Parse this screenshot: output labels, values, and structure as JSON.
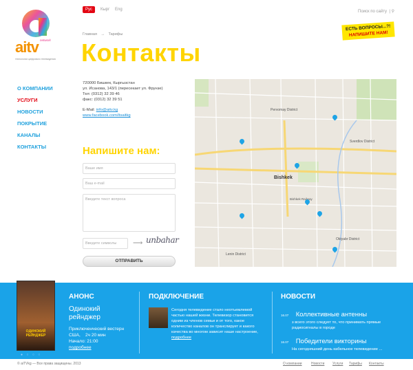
{
  "logo": {
    "name": "aitv",
    "tag": "network",
    "tagline": "технологии цифрового телевидения"
  },
  "languages": [
    "Рус",
    "Кырг",
    "Eng"
  ],
  "search": {
    "label": "Поиск по сайту"
  },
  "breadcrumb": [
    "Главная",
    "→",
    "Тарифы"
  ],
  "page_title": "Контакты",
  "ask": {
    "line1": "ЕСТЬ ВОПРОСЫ...?!",
    "line2": "НАПИШИТЕ НАМ!"
  },
  "nav": [
    "О КОМПАНИИ",
    "УСЛУГИ",
    "НОВОСТИ",
    "ПОКРЫТИЕ",
    "КАНАЛЫ",
    "КОНТАКТЫ"
  ],
  "address": {
    "line1": "720000 Бишкек, Кыргызстан",
    "line2": "ул. Исанова, 143/1 (пересекает ул. Фрунзе)",
    "phone": "Тел: (0312) 32 39 46",
    "fax": "факс: (0312) 32 39 51",
    "email_label": "E-Mail:",
    "email": "info@aitv.kg",
    "web": "www.facebook.com/itsaitkg"
  },
  "form": {
    "title": "Напишите нам:",
    "name_placeholder": "Ваше имя",
    "email_placeholder": "Ваш e-mail",
    "question_placeholder": "Введите текст вопроса",
    "captcha_placeholder": "Введите символы",
    "captcha_text": "unbahar",
    "submit": "ОТПРАВИТЬ"
  },
  "map": {
    "labels": [
      "Bishkek",
      "Oktyabr District",
      "Pervomay District",
      "Sverdlov District",
      "Lenin District",
      "Bishkek Railway"
    ]
  },
  "anons": {
    "title": "АНОНС",
    "film_title": "Одинокий рейнджер",
    "genre": "Приключенческий вестерн",
    "country": "США,",
    "duration": "2ч 20 мин",
    "start": "Начало: 21:00",
    "more": "подробнее",
    "poster_title": "ОДИНОКИЙ РЕЙНДЖЕР"
  },
  "connect": {
    "title": "ПОДКЛЮЧЕНИЕ",
    "text": "Сегодня телевидение стало неотъемлемой частью нашей жизни. Телевизор становится одним из членов семьи и от того, какое количество каналов он транслирует и какого качества во многом зависит наше настроение,",
    "more": "подробнее"
  },
  "news": {
    "title": "НОВОСТИ",
    "items": [
      {
        "date": "16.07",
        "head": "Коллективные антенны",
        "text": "з всего этого следует то, что принимать прямые радиосигналы в городе"
      },
      {
        "date": "16.07",
        "head": "Победители викторины",
        "text": "На сегодняшний день кабельное телевидение ..."
      }
    ]
  },
  "footer": {
    "copyright": "© aiTVkg — Все права защищены. 2013",
    "links": [
      "О компании",
      "Новости",
      "Услуги",
      "Тарифы",
      "Контакты"
    ]
  },
  "colors": {
    "accent_yellow": "#ffd400",
    "accent_blue": "#1aa3e8",
    "red": "#e30613"
  }
}
